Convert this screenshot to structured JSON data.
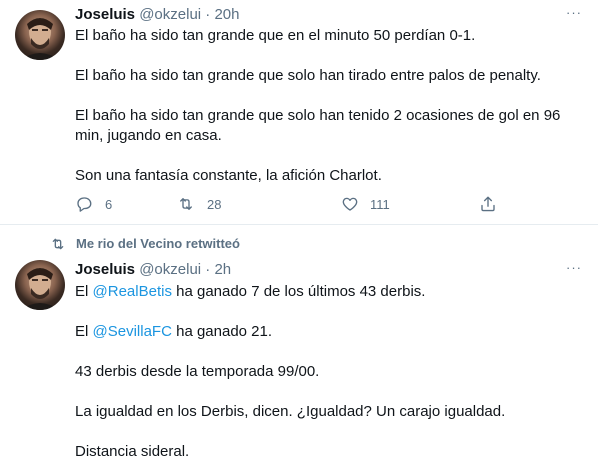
{
  "tweets": [
    {
      "name": "Joseluis",
      "handle": "@okzelui",
      "separator": "·",
      "time": "20h",
      "more": "···",
      "paragraphs": [
        "El baño ha sido tan grande que en el minuto 50 perdían 0-1.",
        "El baño ha sido tan grande que solo han tirado entre palos de penalty.",
        "El baño ha sido tan grande que solo han tenido 2 ocasiones de gol en 96 min,  jugando en casa.",
        "Son una fantasía constante, la afición Charlot."
      ],
      "actions": {
        "reply": {
          "icon": "reply-icon",
          "count": "6"
        },
        "retweet": {
          "icon": "retweet-icon",
          "count": "28"
        },
        "like": {
          "icon": "heart-icon",
          "count": "111"
        },
        "share": {
          "icon": "share-icon"
        }
      }
    },
    {
      "retweet_context": "Me rio del Vecino retwitteó",
      "name": "Joseluis",
      "handle": "@okzelui",
      "separator": "·",
      "time": "2h",
      "more": "···",
      "p1_pre": "El ",
      "p1_mention": "@RealBetis",
      "p1_post": " ha ganado 7 de los últimos 43 derbis.",
      "p2_pre": "El ",
      "p2_mention": "@SevillaFC",
      "p2_post": " ha ganado 21.",
      "p3": "43 derbis desde la temporada 99/00.",
      "p4": "La igualdad en los Derbis, dicen.  ¿Igualdad? Un carajo igualdad.",
      "p5": "Distancia sideral."
    }
  ],
  "colors": {
    "text": "#0f1419",
    "secondary": "#5b7083",
    "link": "#1b95e0",
    "divider": "#e6ecf0"
  }
}
